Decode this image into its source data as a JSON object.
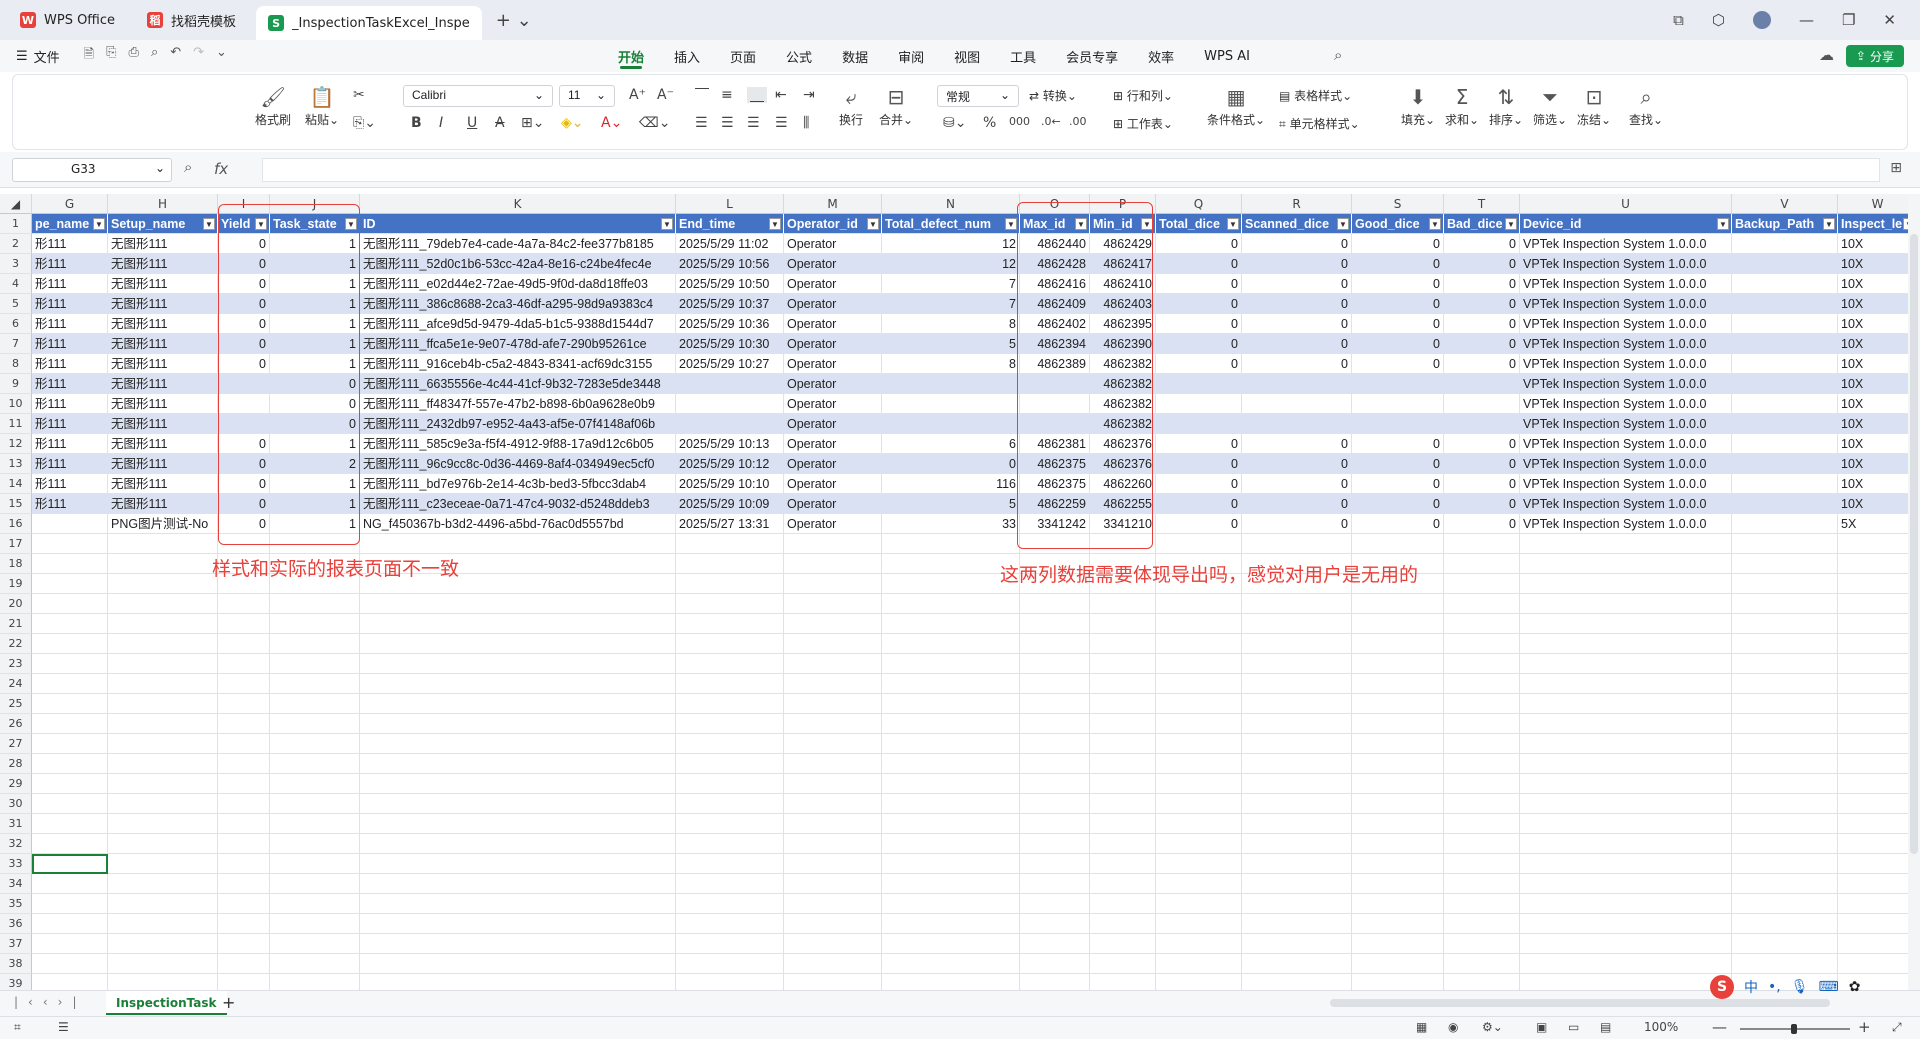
{
  "titlebar": {
    "tabs": [
      {
        "label": "WPS Office",
        "logo": "W",
        "color": "#e8403a"
      },
      {
        "label": "找稻壳模板",
        "logo": "稻",
        "color": "#e8403a"
      },
      {
        "label": "_InspectionTaskExcel_Inspe",
        "logo": "S",
        "color": "#1a9a50"
      }
    ]
  },
  "menubar": {
    "file_label": "文件",
    "tabs": [
      "开始",
      "插入",
      "页面",
      "公式",
      "数据",
      "审阅",
      "视图",
      "工具",
      "会员专享",
      "效率",
      "WPS AI"
    ],
    "active_tab": "开始",
    "share_label": "分享"
  },
  "ribbon": {
    "format_painter": "格式刷",
    "paste": "粘贴",
    "font_name": "Calibri",
    "font_size": "11",
    "wrap": "换行",
    "merge": "合并",
    "number_format": "常规",
    "convert": "转换",
    "row_col": "行和列",
    "worksheet": "工作表",
    "conditional_format": "条件格式",
    "table_style": "表格样式",
    "cell_style": "单元格样式",
    "fill": "填充",
    "sum": "求和",
    "sort": "排序",
    "filter": "筛选",
    "freeze": "冻结",
    "find": "查找"
  },
  "formula_bar": {
    "name_box": "G33",
    "fx": "fx",
    "content": ""
  },
  "sheet": {
    "columns": [
      "G",
      "H",
      "I",
      "J",
      "K",
      "L",
      "M",
      "N",
      "O",
      "P",
      "Q",
      "R",
      "S",
      "T",
      "U",
      "V",
      "W"
    ],
    "headers": [
      "pe_name",
      "Setup_name",
      "Yield",
      "Task_state",
      "ID",
      "End_time",
      "Operator_id",
      "Total_defect_num",
      "Max_id",
      "Min_id",
      "Total_dice",
      "Scanned_dice",
      "Good_dice",
      "Bad_dice",
      "Device_id",
      "Backup_Path",
      "Inspect_len"
    ],
    "rows": [
      [
        "形111",
        "无图形111",
        "0",
        "1",
        "无图形111_79deb7e4-cade-4a7a-84c2-fee377b8185",
        "2025/5/29 11:02",
        "Operator",
        "12",
        "4862440",
        "4862429",
        "0",
        "0",
        "0",
        "0",
        "VPTek Inspection System 1.0.0.0",
        "",
        "10X"
      ],
      [
        "形111",
        "无图形111",
        "0",
        "1",
        "无图形111_52d0c1b6-53cc-42a4-8e16-c24be4fec4e",
        "2025/5/29 10:56",
        "Operator",
        "12",
        "4862428",
        "4862417",
        "0",
        "0",
        "0",
        "0",
        "VPTek Inspection System 1.0.0.0",
        "",
        "10X"
      ],
      [
        "形111",
        "无图形111",
        "0",
        "1",
        "无图形111_e02d44e2-72ae-49d5-9f0d-da8d18ffe03",
        "2025/5/29 10:50",
        "Operator",
        "7",
        "4862416",
        "4862410",
        "0",
        "0",
        "0",
        "0",
        "VPTek Inspection System 1.0.0.0",
        "",
        "10X"
      ],
      [
        "形111",
        "无图形111",
        "0",
        "1",
        "无图形111_386c8688-2ca3-46df-a295-98d9a9383c4",
        "2025/5/29 10:37",
        "Operator",
        "7",
        "4862409",
        "4862403",
        "0",
        "0",
        "0",
        "0",
        "VPTek Inspection System 1.0.0.0",
        "",
        "10X"
      ],
      [
        "形111",
        "无图形111",
        "0",
        "1",
        "无图形111_afce9d5d-9479-4da5-b1c5-9388d1544d7",
        "2025/5/29 10:36",
        "Operator",
        "8",
        "4862402",
        "4862395",
        "0",
        "0",
        "0",
        "0",
        "VPTek Inspection System 1.0.0.0",
        "",
        "10X"
      ],
      [
        "形111",
        "无图形111",
        "0",
        "1",
        "无图形111_ffca5e1e-9e07-478d-afe7-290b95261ce",
        "2025/5/29 10:30",
        "Operator",
        "5",
        "4862394",
        "4862390",
        "0",
        "0",
        "0",
        "0",
        "VPTek Inspection System 1.0.0.0",
        "",
        "10X"
      ],
      [
        "形111",
        "无图形111",
        "0",
        "1",
        "无图形111_916ceb4b-c5a2-4843-8341-acf69dc3155",
        "2025/5/29 10:27",
        "Operator",
        "8",
        "4862389",
        "4862382",
        "0",
        "0",
        "0",
        "0",
        "VPTek Inspection System 1.0.0.0",
        "",
        "10X"
      ],
      [
        "形111",
        "无图形111",
        "",
        "0",
        "无图形111_6635556e-4c44-41cf-9b32-7283e5de3448",
        "",
        "Operator",
        "",
        "",
        "4862382",
        "",
        "",
        "",
        "",
        "VPTek Inspection System 1.0.0.0",
        "",
        "10X"
      ],
      [
        "形111",
        "无图形111",
        "",
        "0",
        "无图形111_ff48347f-557e-47b2-b898-6b0a9628e0b9",
        "",
        "Operator",
        "",
        "",
        "4862382",
        "",
        "",
        "",
        "",
        "VPTek Inspection System 1.0.0.0",
        "",
        "10X"
      ],
      [
        "形111",
        "无图形111",
        "",
        "0",
        "无图形111_2432db97-e952-4a43-af5e-07f4148af06b",
        "",
        "Operator",
        "",
        "",
        "4862382",
        "",
        "",
        "",
        "",
        "VPTek Inspection System 1.0.0.0",
        "",
        "10X"
      ],
      [
        "形111",
        "无图形111",
        "0",
        "1",
        "无图形111_585c9e3a-f5f4-4912-9f88-17a9d12c6b05",
        "2025/5/29 10:13",
        "Operator",
        "6",
        "4862381",
        "4862376",
        "0",
        "0",
        "0",
        "0",
        "VPTek Inspection System 1.0.0.0",
        "",
        "10X"
      ],
      [
        "形111",
        "无图形111",
        "0",
        "2",
        "无图形111_96c9cc8c-0d36-4469-8af4-034949ec5cf0",
        "2025/5/29 10:12",
        "Operator",
        "0",
        "4862375",
        "4862376",
        "0",
        "0",
        "0",
        "0",
        "VPTek Inspection System 1.0.0.0",
        "",
        "10X"
      ],
      [
        "形111",
        "无图形111",
        "0",
        "1",
        "无图形111_bd7e976b-2e14-4c3b-bed3-5fbcc3dab4",
        "2025/5/29 10:10",
        "Operator",
        "116",
        "4862375",
        "4862260",
        "0",
        "0",
        "0",
        "0",
        "VPTek Inspection System 1.0.0.0",
        "",
        "10X"
      ],
      [
        "形111",
        "无图形111",
        "0",
        "1",
        "无图形111_c23eceae-0a71-47c4-9032-d5248ddeb3",
        "2025/5/29 10:09",
        "Operator",
        "5",
        "4862259",
        "4862255",
        "0",
        "0",
        "0",
        "0",
        "VPTek Inspection System 1.0.0.0",
        "",
        "10X"
      ],
      [
        "",
        "PNG图片测试-No",
        "0",
        "1",
        "NG_f450367b-b3d2-4496-a5bd-76ac0d5557bd",
        "2025/5/27 13:31",
        "Operator",
        "33",
        "3341242",
        "3341210",
        "0",
        "0",
        "0",
        "0",
        "VPTek Inspection System 1.0.0.0",
        "",
        "5X"
      ]
    ],
    "row_numbers": [
      "1",
      "2",
      "3",
      "4",
      "5",
      "6",
      "7",
      "8",
      "9",
      "10",
      "11",
      "12",
      "13",
      "14",
      "15",
      "16",
      "17",
      "18",
      "19",
      "20",
      "21",
      "22",
      "23",
      "24",
      "25",
      "26",
      "27",
      "28",
      "29",
      "30",
      "31",
      "32",
      "33",
      "34",
      "35",
      "36",
      "37",
      "38",
      "39"
    ],
    "numeric_columns": [
      2,
      3,
      7,
      8,
      9,
      10,
      11,
      12,
      13
    ],
    "selected_cell": "G33"
  },
  "annotations": {
    "left_note": "样式和实际的报表页面不一致",
    "right_note": "这两列数据需要体现导出吗，感觉对用户是无用的"
  },
  "sheet_tabs": {
    "active": "InspectionTask"
  },
  "status": {
    "zoom": "100%"
  }
}
